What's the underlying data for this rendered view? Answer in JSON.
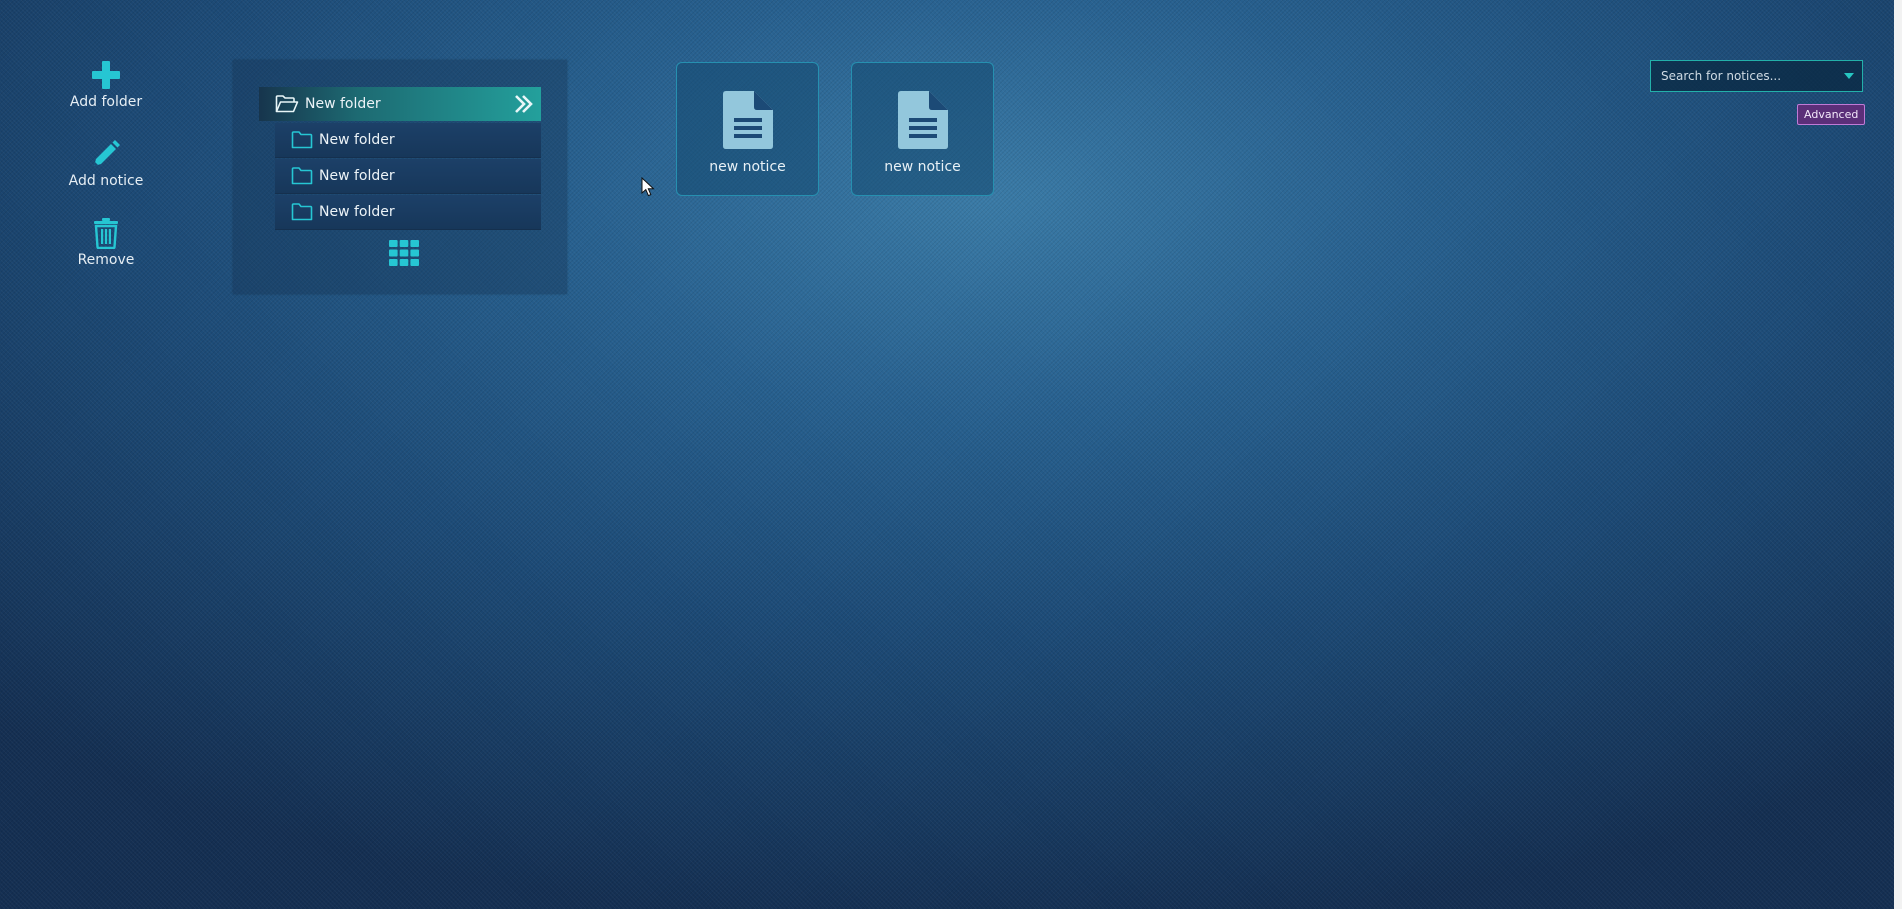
{
  "toolbar": {
    "add_folder": {
      "label": "Add folder",
      "icon": "plus-icon"
    },
    "add_notice": {
      "label": "Add notice",
      "icon": "pencil-icon"
    },
    "remove": {
      "label": "Remove",
      "icon": "trash-icon"
    }
  },
  "folders": {
    "root": {
      "label": "New folder",
      "icon": "folder-open-icon",
      "expand_icon": "double-chevron-right-icon"
    },
    "children": [
      {
        "label": "New folder",
        "icon": "folder-icon"
      },
      {
        "label": "New folder",
        "icon": "folder-icon"
      },
      {
        "label": "New folder",
        "icon": "folder-icon"
      }
    ],
    "grid_icon": "grid-icon"
  },
  "notices": [
    {
      "title": "new notice",
      "icon": "document-icon"
    },
    {
      "title": "new notice",
      "icon": "document-icon"
    }
  ],
  "search": {
    "placeholder": "Search for notices...",
    "value": "",
    "dropdown_icon": "caret-down-icon"
  },
  "advanced_label": "Advanced",
  "colors": {
    "accent": "#26c6d3",
    "advanced_bg": "#5b2f79",
    "folder_highlight": "#23a09c",
    "background": "#1c4a76"
  }
}
